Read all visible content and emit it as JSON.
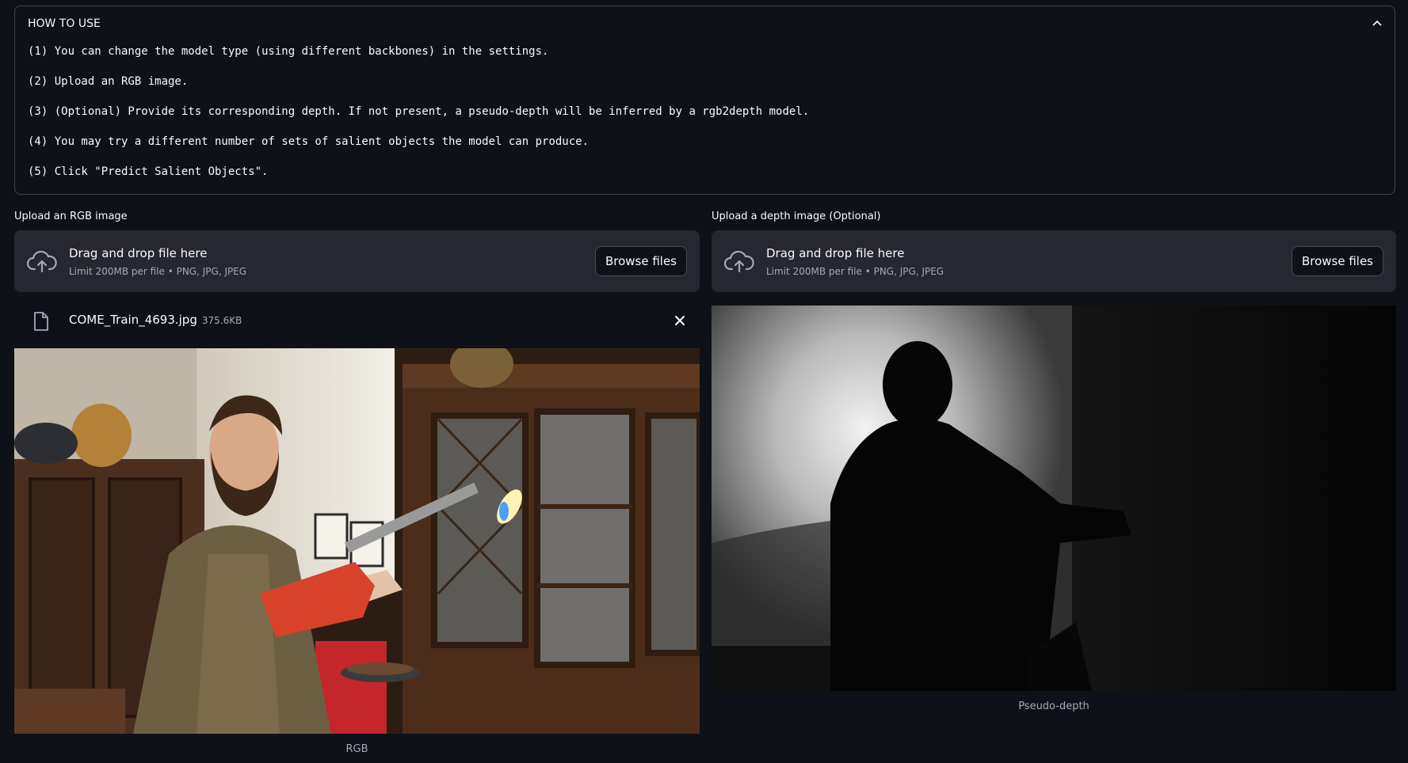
{
  "expander": {
    "title": "HOW TO USE",
    "steps": [
      "(1) You can change the model type (using different backbones) in the settings.",
      "(2) Upload an RGB image.",
      "(3) (Optional) Provide its corresponding depth. If not present, a pseudo-depth will be inferred by a rgb2depth model.",
      "(4) You may try a different number of sets of salient objects the model can produce.",
      "(5) Click \"Predict Salient Objects\"."
    ]
  },
  "rgb_uploader": {
    "label": "Upload an RGB image",
    "drop_text": "Drag and drop file here",
    "limit_text": "Limit 200MB per file • PNG, JPG, JPEG",
    "browse_label": "Browse files",
    "file_name": "COME_Train_4693.jpg",
    "file_size": "375.6KB",
    "caption": "RGB"
  },
  "depth_uploader": {
    "label": "Upload a depth image (Optional)",
    "drop_text": "Drag and drop file here",
    "limit_text": "Limit 200MB per file • PNG, JPG, JPEG",
    "browse_label": "Browse files",
    "caption": "Pseudo-depth"
  },
  "colors": {
    "background": "#0e1117",
    "panel": "#262730",
    "text": "#fafafa",
    "muted": "#a3a8b8"
  },
  "icons": [
    "chevron-up-icon",
    "cloud-upload-icon",
    "file-icon",
    "close-icon"
  ]
}
